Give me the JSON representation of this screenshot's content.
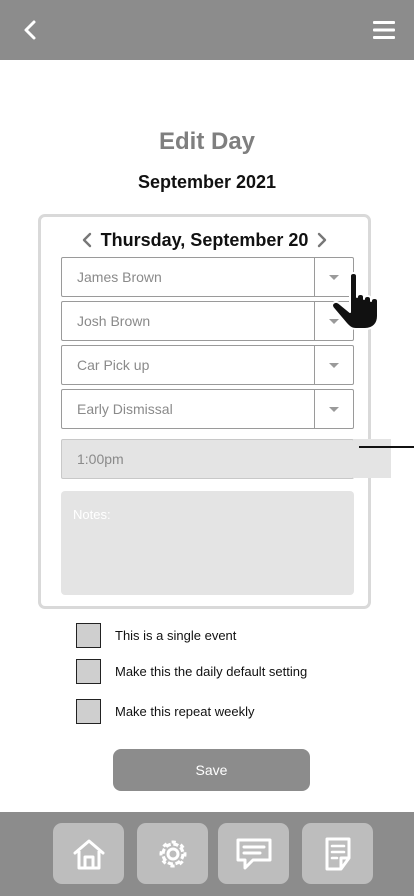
{
  "header": {
    "back_icon": "chevron-left-icon",
    "menu_icon": "hamburger-menu-icon"
  },
  "page": {
    "title": "Edit Day",
    "month": "September 2021"
  },
  "card": {
    "date": "Thursday, September 20",
    "prev_icon": "chevron-left-icon",
    "next_icon": "chevron-right-icon",
    "selects": [
      {
        "value": "James Brown"
      },
      {
        "value": "Josh Brown"
      },
      {
        "value": "Car Pick up"
      },
      {
        "value": "Early Dismissal"
      }
    ],
    "time": {
      "value": "1:00pm"
    },
    "notes": {
      "placeholder": "Notes:"
    }
  },
  "options": [
    {
      "label": "This is a single event",
      "checked": false
    },
    {
      "label": "Make this the daily default setting",
      "checked": false
    },
    {
      "label": "Make this repeat weekly",
      "checked": false
    }
  ],
  "save_label": "Save",
  "bottom_nav": [
    {
      "icon": "home-icon"
    },
    {
      "icon": "gear-icon"
    },
    {
      "icon": "chat-icon"
    },
    {
      "icon": "notes-icon"
    }
  ],
  "colors": {
    "bar": "#8c8c8c",
    "tile": "#bdbdbd",
    "field_fill": "#e4e4e4",
    "title_gray": "#7f7f7f"
  }
}
